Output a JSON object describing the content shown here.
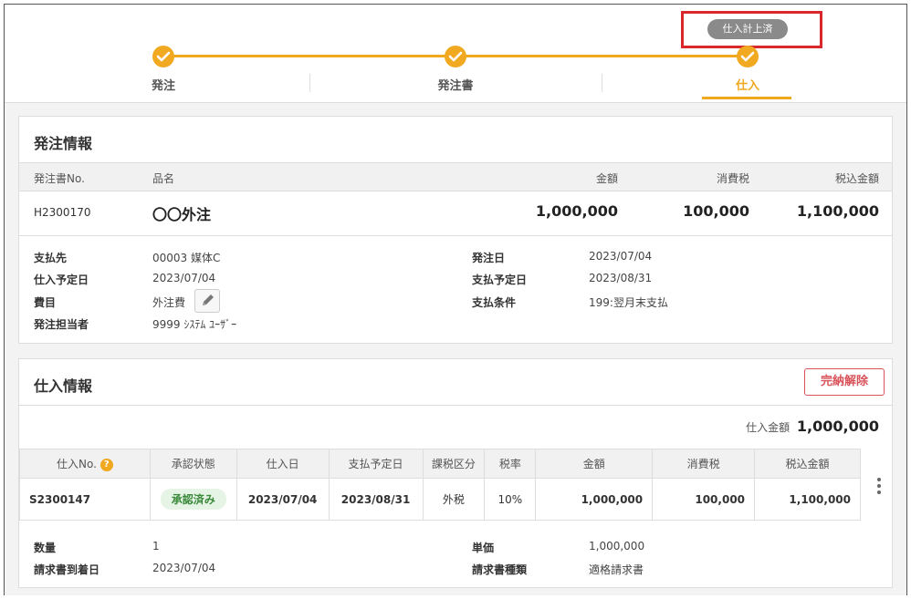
{
  "status_badge": "仕入計上済",
  "steps": [
    {
      "label": "発注"
    },
    {
      "label": "発注書"
    },
    {
      "label": "仕入"
    }
  ],
  "order_info": {
    "title": "発注情報",
    "headers": {
      "order_no": "発注書No.",
      "item": "品名",
      "amount": "金額",
      "tax": "消費税",
      "total": "税込金額"
    },
    "row": {
      "order_no": "H2300170",
      "item": "〇〇外注",
      "amount": "1,000,000",
      "tax": "100,000",
      "total": "1,100,000"
    },
    "details_left": [
      {
        "label": "支払先",
        "value": "00003  媒体C"
      },
      {
        "label": "仕入予定日",
        "value": "2023/07/04"
      },
      {
        "label": "費目",
        "value": "外注費"
      },
      {
        "label": "発注担当者",
        "value": "9999  ｼｽﾃﾑ  ﾕｰｻﾞｰ"
      }
    ],
    "details_right": [
      {
        "label": "発注日",
        "value": "2023/07/04"
      },
      {
        "label": "支払予定日",
        "value": "2023/08/31"
      },
      {
        "label": "支払条件",
        "value": "199:翌月末支払"
      }
    ]
  },
  "purchase_info": {
    "title": "仕入情報",
    "release_button": "完納解除",
    "total_label": "仕入金額",
    "total_value": "1,000,000",
    "columns": [
      "仕入No.",
      "承認状態",
      "仕入日",
      "支払予定日",
      "課税区分",
      "税率",
      "金額",
      "消費税",
      "税込金額"
    ],
    "help_icon_glyph": "?",
    "row": {
      "no": "S2300147",
      "status": "承認済み",
      "date": "2023/07/04",
      "pay_date": "2023/08/31",
      "tax_class": "外税",
      "rate": "10%",
      "amount": "1,000,000",
      "tax": "100,000",
      "total": "1,100,000"
    },
    "details_left": [
      {
        "label": "数量",
        "value": "1"
      },
      {
        "label": "請求書到着日",
        "value": "2023/07/04"
      }
    ],
    "details_right": [
      {
        "label": "単価",
        "value": "1,000,000"
      },
      {
        "label": "請求書種類",
        "value": "適格請求書"
      }
    ]
  },
  "colors": {
    "accent": "#f0a81e",
    "highlight": "#d9272e",
    "danger": "#d9535a",
    "approved_bg": "#e6f4e6",
    "approved_text": "#3a8a3a"
  }
}
